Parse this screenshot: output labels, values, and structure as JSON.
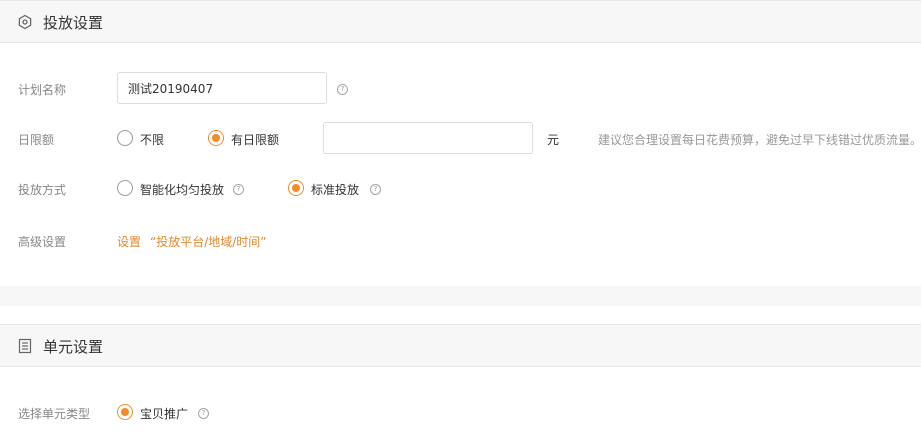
{
  "delivery": {
    "title": "投放设置",
    "icon": "hexagon-settings-icon",
    "plan_name": {
      "label": "计划名称",
      "value": "测试20190407"
    },
    "daily_limit": {
      "label": "日限额",
      "options": [
        "不限",
        "有日限额"
      ],
      "selected_index": 1,
      "amount_value": "",
      "unit": "元",
      "hint": "建议您合理设置每日花费预算，避免过早下线错过优质流量。"
    },
    "delivery_method": {
      "label": "投放方式",
      "options": [
        "智能化均匀投放",
        "标准投放"
      ],
      "selected_index": 1
    },
    "advanced": {
      "label": "高级设置",
      "link_text": "设置",
      "link_detail": "“投放平台/地域/时间”"
    }
  },
  "unit": {
    "title": "单元设置",
    "icon": "document-list-icon",
    "unit_type": {
      "label": "选择单元类型",
      "options": [
        "宝贝推广"
      ],
      "selected_index": 0
    }
  },
  "help_glyph": "?",
  "colors": {
    "accent": "#f08c2a",
    "link": "#e08a2e"
  }
}
